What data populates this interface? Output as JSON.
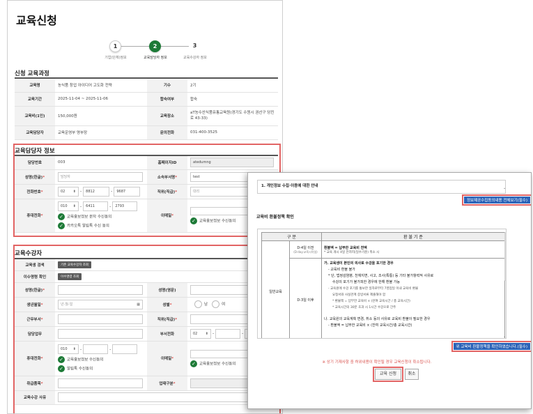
{
  "page": {
    "title": "교육신청"
  },
  "steps": [
    {
      "num": "1",
      "label": "기업(단체)정보"
    },
    {
      "num": "2",
      "label": "교육담당자 정보"
    },
    {
      "num": "3",
      "label": "교육수강자 정보"
    }
  ],
  "course": {
    "section_title": "신청 교육과정",
    "rows": [
      {
        "l1": "교육명",
        "v1": "농식품 창업 아이디어 고도화 전략",
        "l2": "기수",
        "v2": "2기"
      },
      {
        "l1": "교육기간",
        "v1": "2025-11-04 ~ 2025-11-06",
        "l2": "합숙여부",
        "v2": "합숙"
      },
      {
        "l1": "교육비(1인)",
        "v1": "150,000원",
        "l2": "교육장소",
        "v2": "aT농수산식품유통교육원(경기도 수원시 권선구 당진로 43-33)"
      },
      {
        "l1": "교육담당자",
        "v1": "교육운영부 명부장",
        "l2": "문의전화",
        "v2": "031-400-3525"
      }
    ]
  },
  "manager": {
    "section_title": "교육담당자 정보",
    "labels": {
      "number": "담당번호",
      "homepage_id": "홈페이지ID",
      "name": "성명(한글)",
      "dept": "소속부서명",
      "phone": "전화번호",
      "position": "직위(직급)",
      "mobile": "휴대전화",
      "email": "이메일"
    },
    "values": {
      "number": "003",
      "homepage_id": "atedumng",
      "name_placeholder": "담당자",
      "dept": "test",
      "phone_area": "02",
      "phone_mid": "8812",
      "phone_last": "9687",
      "position": "대리",
      "mobile_prefix": "010",
      "mobile_mid": "6411",
      "mobile_last": "2793"
    },
    "sms_consent": "교육홍보정보 문자 수신동의",
    "kakao_consent": "카카오톡 알림톡 수신 동의",
    "email_consent": "교육홍보정보 수신동의"
  },
  "trainee": {
    "section_title": "교육수강자",
    "labels": {
      "search": "교육생 검색",
      "history": "이수명령 확인",
      "name_kr": "성명(한글)",
      "name_en": "성명(영문)",
      "birth": "생년월일",
      "gender": "성별",
      "dept": "근무부서",
      "position": "직위(직급)",
      "duty": "담당업무",
      "dept_phone": "부서전화",
      "mobile": "휴대전화",
      "email": "이메일",
      "category": "취급품목",
      "business_type": "업태구분",
      "reason": "교육수강 사유"
    },
    "search_button": "기존 교육수강자 조회",
    "history_button": "이수명령 조회",
    "birth_placeholder": "년-월-일",
    "gender_male": "남",
    "gender_female": "여",
    "dept_phone_area": "02",
    "mobile_prefix": "010",
    "sms_consent": "교육홍보정보 수신동의",
    "kakao_consent": "알림톡 수신동의",
    "email_consent": "교육홍보정보 수신동의"
  },
  "modal": {
    "privacy_title": "1. 개인정보 수집·이용에 대한 안내",
    "privacy_full_button": "정보제공수집동의내용 전체보기(필수)",
    "refund_title": "교육비 환불정책 확인",
    "table_head": {
      "c1": "구 분",
      "c2": "환 불 기 준"
    },
    "group_label": "일반교육",
    "row1": {
      "period": "D-4일 이전",
      "period_note": "(D-day:교육시작일)",
      "rule": "환불액 = 납부한 교육비 전액",
      "note": "* 교육 개시 4일 전까지(일수기준) 취소 시"
    },
    "row2": {
      "period": "D-3일 이후",
      "lines": [
        "가. 교육생이 본인의 의사로 수강을 포기한 경우",
        "- 교육비 환불 불가",
        "* 단, 법정감염병, 천재지변, 사고, 조사(특통) 등 기타 불가항력적 사유로",
        "수강의 포기가 불가피한 경우에 한해 환불 가능",
        "- 교육원에 수강 포기를 통보한 일자로부터 7영업일 이내 교육비 환불",
        "요청서와 사실관계 증빙서류 제출해야 함",
        "* 환불액 = 납부한 교육비 × (잔여 교육시간 / 총 교육시간)",
        "* 교육시간의 30분 초과 시 1시간 수강으로 간주",
        "나. 교육원의 교육계획 변경, 취소 등의 사유로 교육비 환불이 필요한 경우",
        "- 환불액 = 납부한 교육비 × (잔여 교육시간/총 교육시간)"
      ]
    },
    "agree_button": "위 교육비 환불정책을 확인하였습니다.(필수)",
    "warning": "※ 상기 기재사항 중 허위내용이 확인될 경우 교육신청이 취소됩니다.",
    "apply_button": "교육 신청",
    "cancel_button": "취소"
  }
}
